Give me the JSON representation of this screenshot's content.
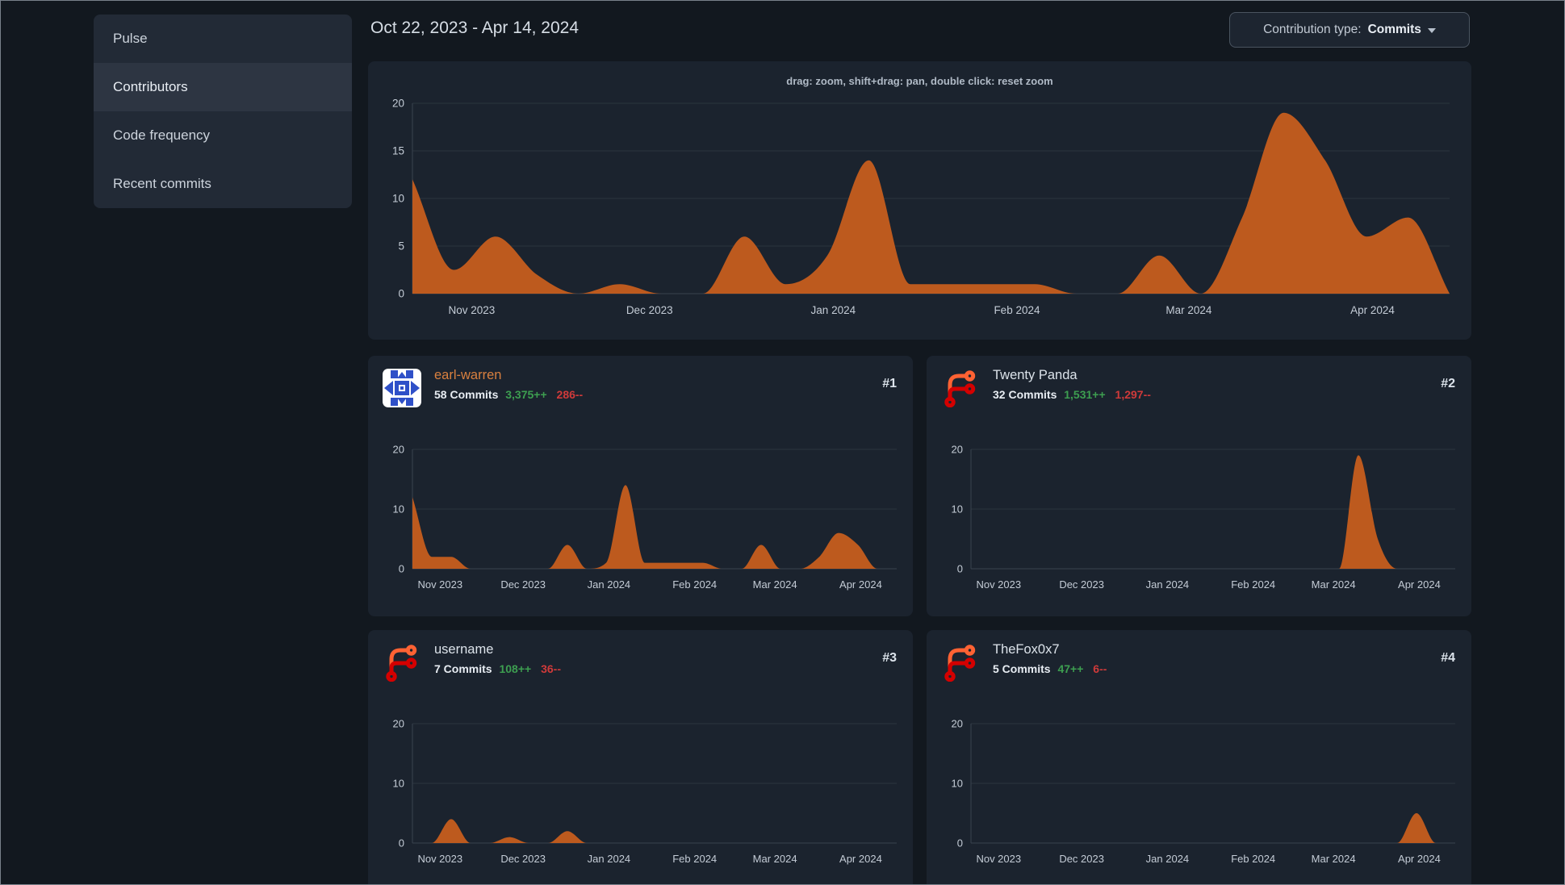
{
  "sidebar": {
    "items": [
      {
        "label": "Pulse",
        "selected": false
      },
      {
        "label": "Contributors",
        "selected": true
      },
      {
        "label": "Code frequency",
        "selected": false
      },
      {
        "label": "Recent commits",
        "selected": false
      }
    ]
  },
  "header": {
    "date_range": "Oct 22, 2023 - Apr 14, 2024",
    "contribution_type": {
      "label": "Contribution type:",
      "value": "Commits"
    }
  },
  "contributors": [
    {
      "rank": "#1",
      "name": "earl-warren",
      "linked": true,
      "avatar": "identicon-avatar",
      "commits": "58 Commits",
      "additions": "3,375++",
      "deletions": "286--"
    },
    {
      "rank": "#2",
      "name": "Twenty Panda",
      "linked": false,
      "avatar": "forgejo-logo-avatar",
      "commits": "32 Commits",
      "additions": "1,531++",
      "deletions": "1,297--"
    },
    {
      "rank": "#3",
      "name": "username",
      "linked": false,
      "avatar": "forgejo-logo-avatar",
      "commits": "7 Commits",
      "additions": "108++",
      "deletions": "36--"
    },
    {
      "rank": "#4",
      "name": "TheFox0x7",
      "linked": false,
      "avatar": "forgejo-logo-avatar",
      "commits": "5 Commits",
      "additions": "47++",
      "deletions": "6--"
    }
  ],
  "colors": {
    "series_orange": "#bd5a1e",
    "additions_green": "#3d9e50",
    "deletions_red": "#cf3a3a",
    "link_orange": "#d9803f",
    "grid": "#2b343f",
    "axis_line": "#3a434f",
    "tick_text": "#c4ccd6"
  },
  "chart_data": [
    {
      "id": "overview-all-contributions",
      "type": "area",
      "title": "drag: zoom, shift+drag: pan, double click: reset zoom",
      "x_start": "Oct 22, 2023",
      "x_end": "Apr 14, 2024",
      "interval": "weekly",
      "month_ticks": [
        "Nov 2023",
        "Dec 2023",
        "Jan 2024",
        "Feb 2024",
        "Mar 2024",
        "Apr 2024"
      ],
      "month_day_offsets": [
        10,
        40,
        71,
        102,
        131,
        162
      ],
      "total_days": 175,
      "ylim": [
        0,
        20
      ],
      "yticks": [
        0,
        5,
        10,
        15,
        20
      ],
      "values": [
        12,
        2.5,
        6,
        2,
        0,
        1,
        0,
        0,
        6,
        1,
        4,
        14,
        1,
        1,
        1,
        1,
        0,
        0,
        4,
        0,
        8,
        19,
        14,
        6,
        8,
        0
      ]
    },
    {
      "id": "earl-warren-commits",
      "type": "area",
      "month_ticks": [
        "Nov 2023",
        "Dec 2023",
        "Jan 2024",
        "Feb 2024",
        "Mar 2024",
        "Apr 2024"
      ],
      "month_day_offsets": [
        10,
        40,
        71,
        102,
        131,
        162
      ],
      "total_days": 175,
      "ylim": [
        0,
        20
      ],
      "yticks": [
        0,
        10,
        20
      ],
      "values": [
        12,
        2,
        2,
        0,
        0,
        0,
        0,
        0,
        4,
        0,
        1,
        14,
        1,
        1,
        1,
        1,
        0,
        0,
        4,
        0,
        0,
        2,
        6,
        4,
        0,
        0
      ]
    },
    {
      "id": "twenty-panda-commits",
      "type": "area",
      "month_ticks": [
        "Nov 2023",
        "Dec 2023",
        "Jan 2024",
        "Feb 2024",
        "Mar 2024",
        "Apr 2024"
      ],
      "month_day_offsets": [
        10,
        40,
        71,
        102,
        131,
        162
      ],
      "total_days": 175,
      "ylim": [
        0,
        20
      ],
      "yticks": [
        0,
        10,
        20
      ],
      "values": [
        0,
        0,
        0,
        0,
        0,
        0,
        0,
        0,
        0,
        0,
        0,
        0,
        0,
        0,
        0,
        0,
        0,
        0,
        0,
        0,
        19,
        5,
        0,
        0,
        0,
        0
      ]
    },
    {
      "id": "username-commits",
      "type": "area",
      "month_ticks": [
        "Nov 2023",
        "Dec 2023",
        "Jan 2024",
        "Feb 2024",
        "Mar 2024",
        "Apr 2024"
      ],
      "month_day_offsets": [
        10,
        40,
        71,
        102,
        131,
        162
      ],
      "total_days": 175,
      "ylim": [
        0,
        20
      ],
      "yticks": [
        0,
        10,
        20
      ],
      "values": [
        0,
        0,
        4,
        0,
        0,
        1,
        0,
        0,
        2,
        0,
        0,
        0,
        0,
        0,
        0,
        0,
        0,
        0,
        0,
        0,
        0,
        0,
        0,
        0,
        0,
        0
      ]
    },
    {
      "id": "thefox0x7-commits",
      "type": "area",
      "month_ticks": [
        "Nov 2023",
        "Dec 2023",
        "Jan 2024",
        "Feb 2024",
        "Mar 2024",
        "Apr 2024"
      ],
      "month_day_offsets": [
        10,
        40,
        71,
        102,
        131,
        162
      ],
      "total_days": 175,
      "ylim": [
        0,
        20
      ],
      "yticks": [
        0,
        10,
        20
      ],
      "values": [
        0,
        0,
        0,
        0,
        0,
        0,
        0,
        0,
        0,
        0,
        0,
        0,
        0,
        0,
        0,
        0,
        0,
        0,
        0,
        0,
        0,
        0,
        0,
        5,
        0,
        0
      ]
    }
  ]
}
